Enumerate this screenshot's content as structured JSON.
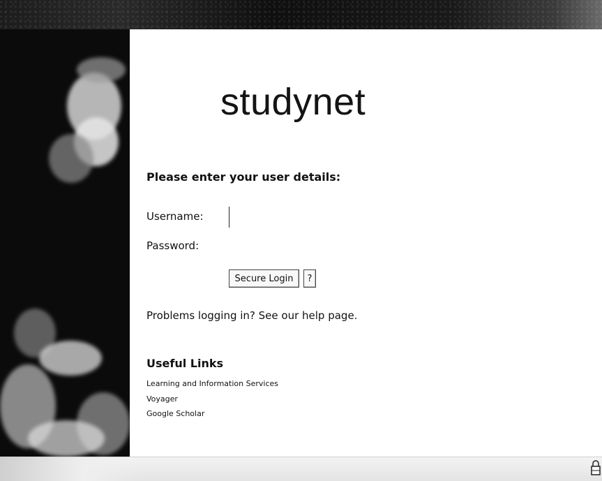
{
  "site": {
    "logo": "studynet"
  },
  "login": {
    "heading": "Please enter your user details:",
    "username_label": "Username:",
    "password_label": "Password:",
    "username_value": "",
    "password_value": "",
    "login_button": "Secure Login",
    "help_button": "?"
  },
  "help_text": "Problems logging in? See our help page.",
  "useful_links": {
    "title": "Useful Links",
    "items": [
      "Learning and Information Services",
      "Voyager",
      "Google Scholar"
    ]
  },
  "icons": {
    "status_bar": "lock-icon"
  },
  "colors": {
    "header_bar": "#1c1c1c",
    "background": "#ffffff",
    "text": "#111111"
  }
}
